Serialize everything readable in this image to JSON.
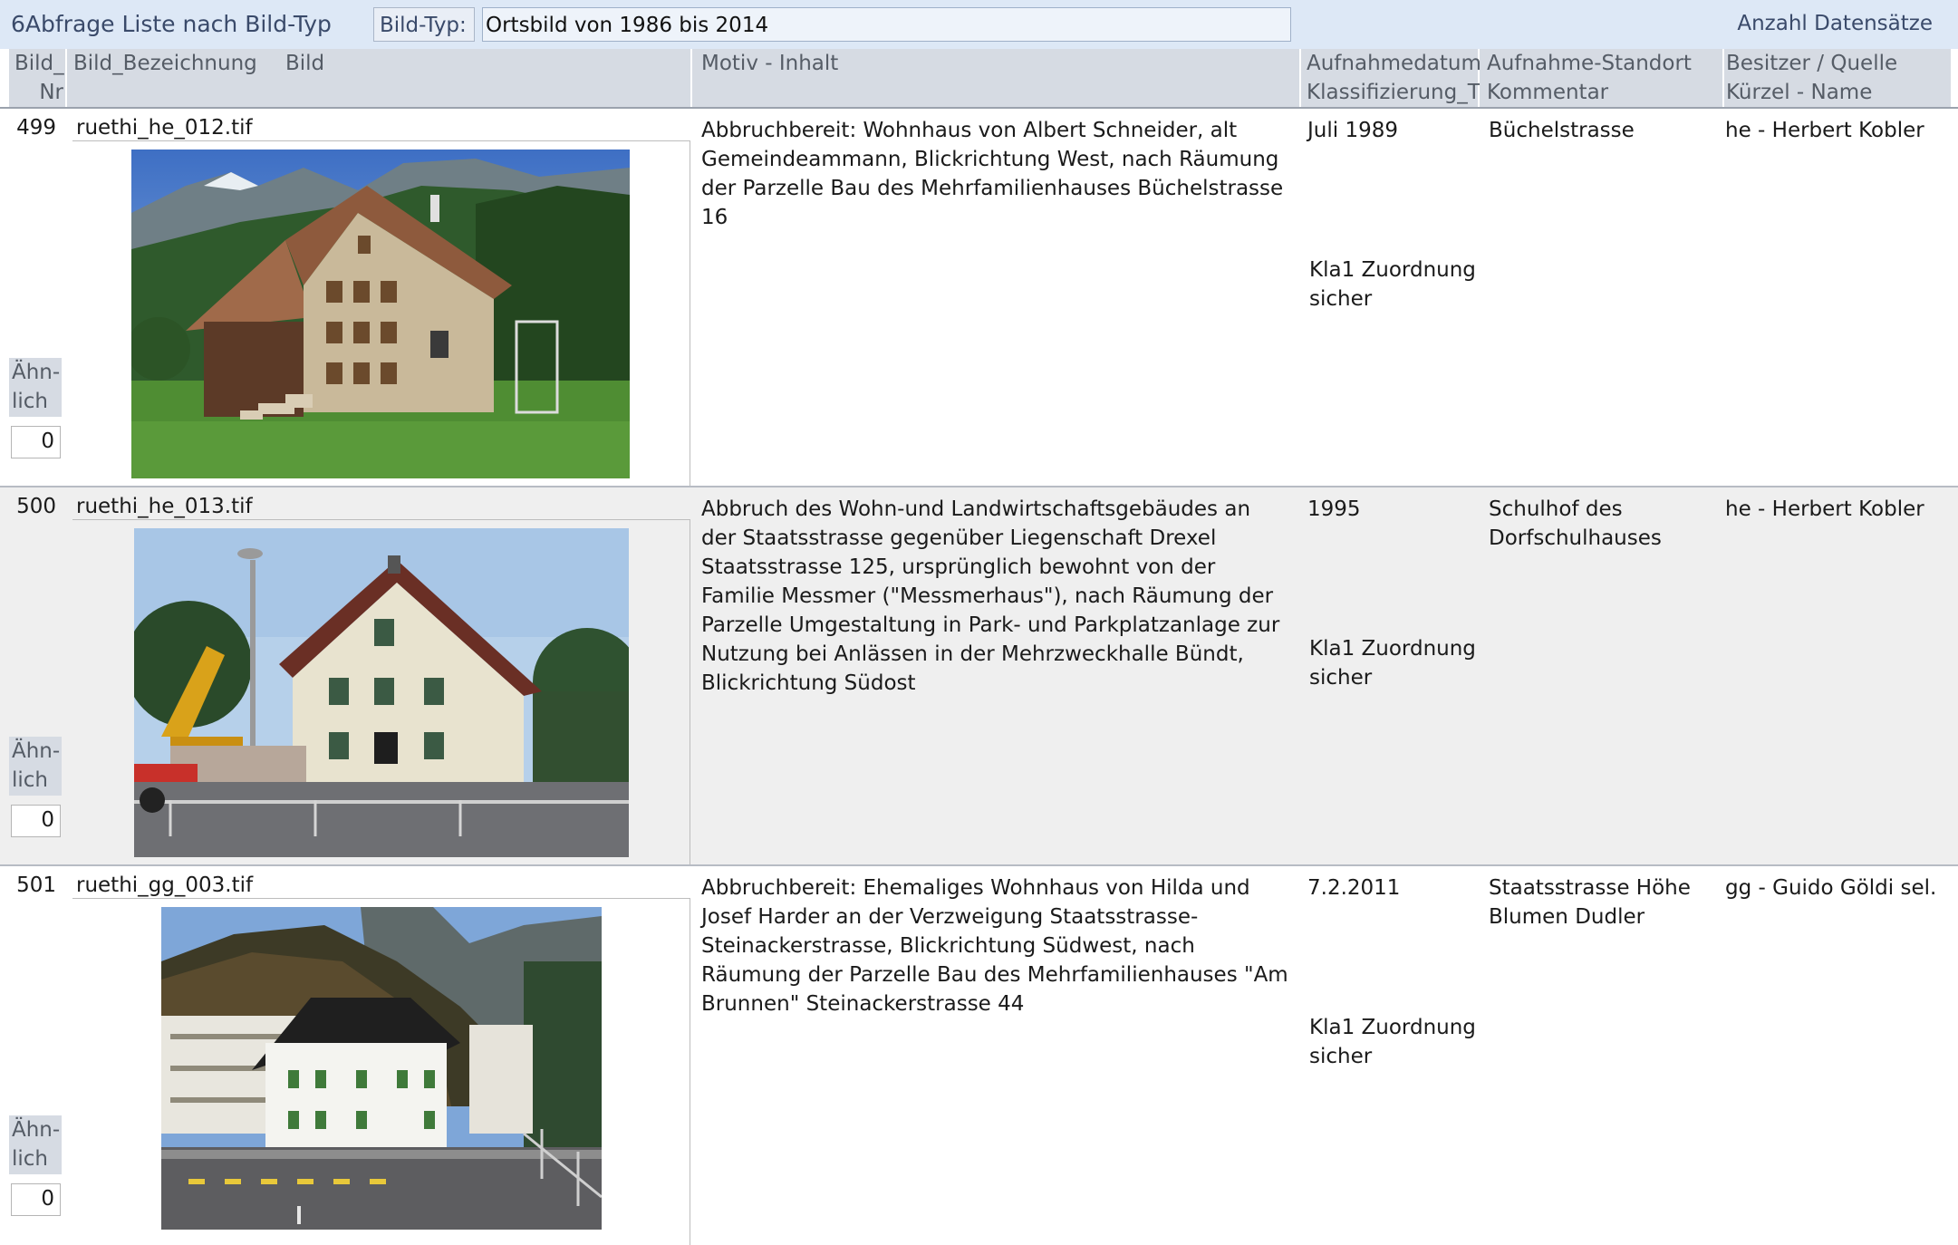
{
  "window": {
    "title": "6Abfrage Liste nach Bild-Typ",
    "filter_label": "Bild-Typ:",
    "filter_value": "Ortsbild von 1986 bis 2014",
    "count_label": "Anzahl Datensätze"
  },
  "columns": {
    "bild_nr_1": "Bild_",
    "bild_nr_2": "Nr",
    "bezeichnung": "Bild_Bezeichnung",
    "bild": "Bild",
    "motiv": "Motiv - Inhalt",
    "datum_1": "Aufnahmedatum",
    "datum_2": "Klassifizierung_T",
    "standort_1": "Aufnahme-Standort",
    "standort_2": "Kommentar",
    "besitzer_1": "Besitzer / Quelle",
    "besitzer_2": "Kürzel - Name"
  },
  "aehnlich_label_1": "Ähn-",
  "aehnlich_label_2": "lich",
  "records": [
    {
      "nr": "499",
      "bezeichnung": "ruethi_he_012.tif",
      "motiv": "Abbruchbereit: Wohnhaus von Albert Schneider, alt Gemeindeammann, Blickrichtung West, nach Räumung der Parzelle Bau des Mehrfamilienhauses Büchelstrasse 16",
      "datum": "Juli 1989",
      "klassifizierung": "Kla1 Zuordnung sicher",
      "standort": "Büchelstrasse",
      "besitzer": "he - Herbert Kobler",
      "aehnlich": "0"
    },
    {
      "nr": "500",
      "bezeichnung": "ruethi_he_013.tif",
      "motiv": "Abbruch des Wohn-und Landwirtschaftsgebäudes an der Staatsstrasse gegenüber Liegenschaft Drexel Staatsstrasse 125, ursprünglich bewohnt von der Familie Messmer (\"Messmerhaus\"), nach Räumung der Parzelle Umgestaltung in Park- und Parkplatzanlage zur Nutzung bei Anlässen in der Mehrzweckhalle Bündt, Blickrichtung Südost",
      "datum": "1995",
      "klassifizierung": "Kla1 Zuordnung sicher",
      "standort": "Schulhof des Dorfschulhauses",
      "besitzer": "he - Herbert Kobler",
      "aehnlich": "0"
    },
    {
      "nr": "501",
      "bezeichnung": "ruethi_gg_003.tif",
      "motiv": "Abbruchbereit: Ehemaliges Wohnhaus von Hilda und Josef Harder an der Verzweigung Staatsstrasse-Steinackerstrasse, Blickrichtung Südwest, nach Räumung der Parzelle Bau des Mehrfamilienhauses \"Am Brunnen\" Steinackerstrasse 44",
      "datum": "7.2.2011",
      "klassifizierung": "Kla1 Zuordnung sicher",
      "standort": "Staatsstrasse Höhe Blumen Dudler",
      "besitzer": "gg - Guido Göldi sel.",
      "aehnlich": "0"
    }
  ]
}
